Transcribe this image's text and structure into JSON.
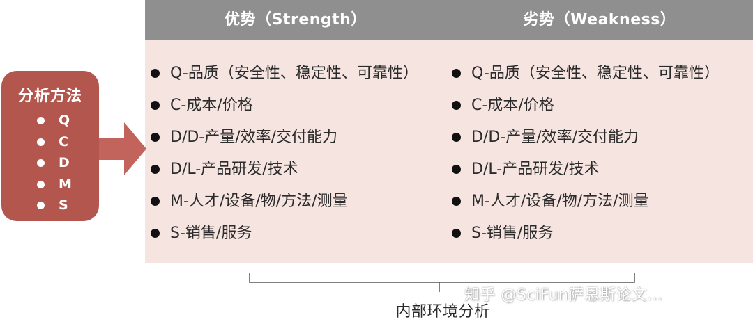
{
  "header": {
    "strength_label": "优势（Strength）",
    "weakness_label": "劣势（Weakness）"
  },
  "method_box": {
    "title": "分析方法",
    "items": [
      "Q",
      "C",
      "D",
      "M",
      "S"
    ]
  },
  "strength_items": [
    "Q-品质（安全性、稳定性、可靠性）",
    "C-成本/价格",
    "D/D-产量/效率/交付能力",
    "D/L-产品研发/技术",
    "M-人才/设备/物/方法/测量",
    "S-销售/服务"
  ],
  "weakness_items": [
    "Q-品质（安全性、稳定性、可靠性）",
    "C-成本/价格",
    "D/D-产量/效率/交付能力",
    "D/L-产品研发/技术",
    "M-人才/设备/物/方法/测量",
    "S-销售/服务"
  ],
  "footer": {
    "label": "内部环境分析",
    "watermark": "知乎 @SciFun萨恩斯论文..."
  },
  "colors": {
    "header_bg": "#8f8f8f",
    "panel_bg": "#f6e4e1",
    "accent": "#b3564d",
    "bullet": "#111111"
  },
  "icons": {
    "arrow": "right-arrow-icon",
    "bracket": "brace-bracket-icon"
  }
}
